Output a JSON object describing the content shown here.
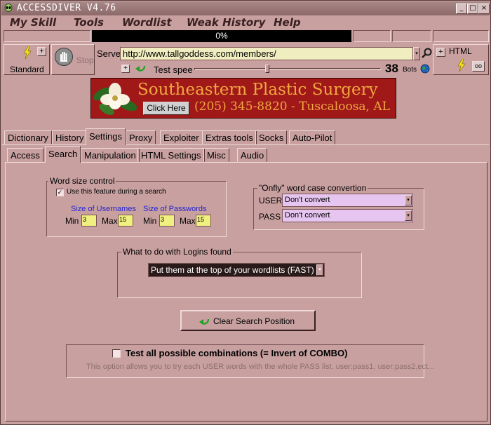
{
  "window": {
    "title": "ACCESSDIVER V4.76"
  },
  "menu": [
    "My Skill",
    "Tools",
    "Wordlist",
    "Weak History",
    "Help"
  ],
  "progress": {
    "text": "0%",
    "percent": 0
  },
  "left_panel": {
    "mode_label": "Standard",
    "stop_label": "Stop"
  },
  "server": {
    "label": "Server",
    "url": "http://www.tallgoddess.com/members/"
  },
  "speed": {
    "label": "Test speed",
    "value": "38",
    "unit": "Bots"
  },
  "right_panel": {
    "html_label": "HTML"
  },
  "banner": {
    "title": "Southeastern Plastic Surgery",
    "button": "Click Here",
    "phone": "(205) 345-8820 - Tuscaloosa, AL"
  },
  "main_tabs": [
    "Dictionary",
    "History",
    "Settings",
    "Proxy",
    "Exploiter",
    "Extras tools",
    "Socks",
    "Auto-Pilot"
  ],
  "main_tab_active": "Settings",
  "sub_tabs": [
    "Access",
    "Search",
    "Manipulation",
    "HTML Settings",
    "Misc",
    "Audio"
  ],
  "sub_tab_active": "Search",
  "word_size": {
    "title": "Word size control",
    "checkbox_label": "Use this feature during a search",
    "checked": true,
    "usernames_label": "Size of Usernames",
    "passwords_label": "Size of Passwords",
    "min_label": "Min",
    "max_label": "Max",
    "user_min": "3",
    "user_max": "15",
    "pass_min": "3",
    "pass_max": "15"
  },
  "case_convert": {
    "title": "\"Onfly\" word case convertion",
    "user_label": "USER",
    "pass_label": "PASS",
    "user_value": "Don't convert",
    "pass_value": "Don't convert"
  },
  "logins": {
    "title": "What to do with Logins found",
    "value": "Put them at the top of your wordlists (FAST)"
  },
  "clear_button": "Clear Search Position",
  "combinations": {
    "label": "Test all possible combinations (= Invert of COMBO)",
    "checked": false,
    "description": "This option allows you to try each USER words with the whole PASS list. user:pass1, user:pass2,ect..."
  },
  "colors": {
    "window_bg": "#c8a0a0",
    "url_bg": "#f0eec0",
    "banner_bg": "#a01818",
    "banner_text": "#f0a840",
    "select_bg": "#e6c6f0",
    "logins_select_bg": "#2a1a1a",
    "link_blue": "#2222d0"
  }
}
